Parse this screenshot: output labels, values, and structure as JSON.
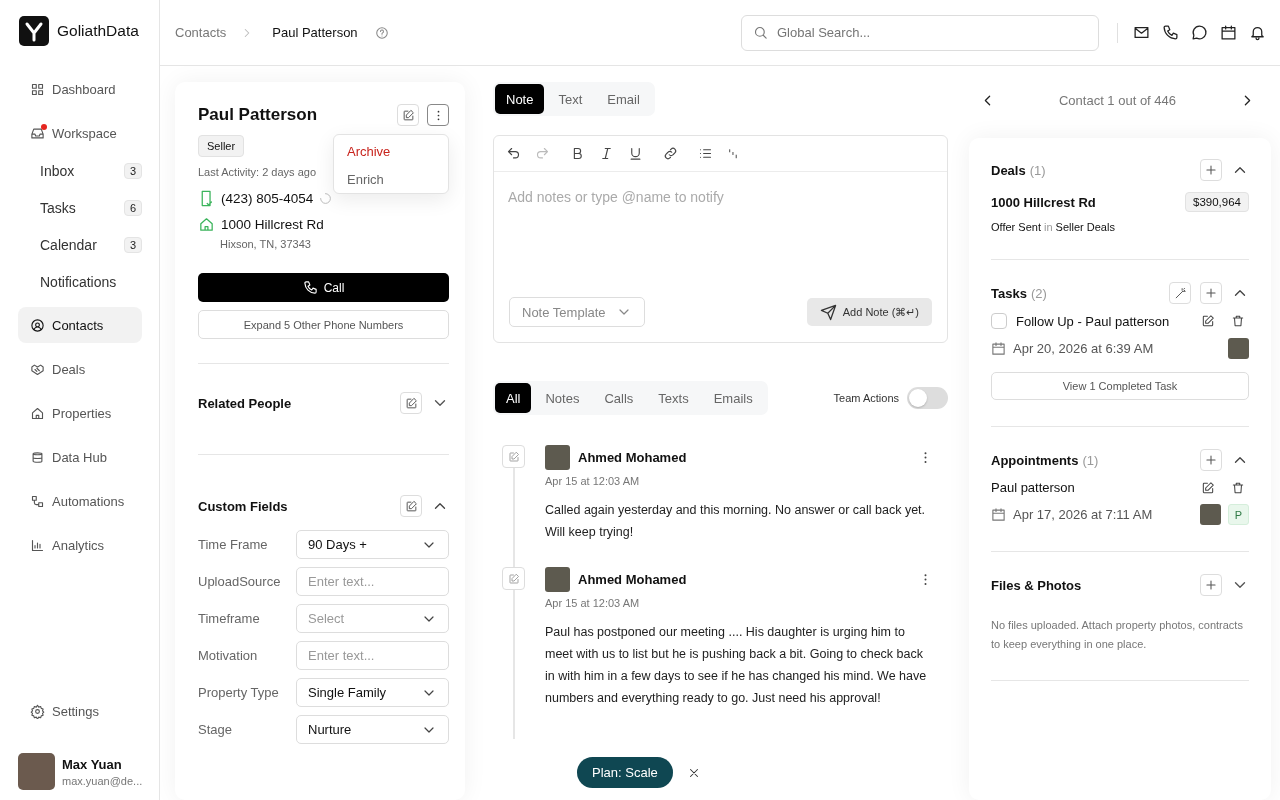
{
  "brand": {
    "name": "GoliathData"
  },
  "nav": [
    {
      "label": "Dashboard",
      "selected": false,
      "alert": false
    },
    {
      "label": "Workspace",
      "selected": false,
      "alert": true,
      "children": [
        {
          "label": "Inbox",
          "count": "3",
          "selected": false
        },
        {
          "label": "Tasks",
          "count": "6",
          "selected": false
        },
        {
          "label": "Calendar",
          "count": "3",
          "selected": false
        },
        {
          "label": "Notifications",
          "selected": false
        }
      ]
    },
    {
      "label": "Contacts",
      "selected": true,
      "alert": false
    },
    {
      "label": "Deals",
      "selected": false,
      "alert": false
    },
    {
      "label": "Properties",
      "selected": false,
      "alert": false
    },
    {
      "label": "Data Hub",
      "selected": false,
      "alert": false
    },
    {
      "label": "Automations",
      "selected": false,
      "alert": false
    },
    {
      "label": "Analytics",
      "selected": false,
      "alert": false
    }
  ],
  "settings": {
    "label": "Settings"
  },
  "user": {
    "name": "Max Yuan",
    "email": "max.yuan@de..."
  },
  "breadcrumb": [
    "Contacts",
    "Paul Patterson"
  ],
  "search": {
    "placeholder": "Global Search..."
  },
  "contact": {
    "name": "Paul Patterson",
    "tag": "Seller",
    "last_activity": "Last Activity: 2 days ago",
    "menu": [
      {
        "label": "Archive",
        "kind": "danger"
      },
      {
        "label": "Enrich",
        "kind": "normal"
      }
    ],
    "phone": "(423) 805-4054",
    "address_line1": "1000 Hillcrest Rd",
    "address_line2": "Hixson, TN, 37343",
    "call_button": "Call",
    "expand_button": "Expand 5 Other Phone Numbers"
  },
  "related_people": {
    "title": "Related People",
    "expanded": false
  },
  "custom_fields": {
    "title": "Custom Fields",
    "expanded": true,
    "fields": [
      {
        "label": "Time Frame",
        "kind": "select",
        "value": "90 Days +"
      },
      {
        "label": "UploadSource",
        "kind": "text",
        "placeholder": "Enter text..."
      },
      {
        "label": "Timeframe",
        "kind": "select",
        "placeholder": "Select"
      },
      {
        "label": "Motivation",
        "kind": "text",
        "placeholder": "Enter text..."
      },
      {
        "label": "Property Type",
        "kind": "select",
        "value": "Single Family"
      },
      {
        "label": "Stage",
        "kind": "select",
        "value": "Nurture"
      }
    ]
  },
  "composer": {
    "tabs": [
      {
        "label": "Note",
        "selected": true
      },
      {
        "label": "Text",
        "selected": false
      },
      {
        "label": "Email",
        "selected": false
      }
    ],
    "placeholder": "Add notes or type @name to notify",
    "template": {
      "placeholder": "Note Template"
    },
    "submit": "Add Note (⌘↵)"
  },
  "activity": {
    "filters": [
      {
        "label": "All",
        "selected": true
      },
      {
        "label": "Notes",
        "selected": false
      },
      {
        "label": "Calls",
        "selected": false
      },
      {
        "label": "Texts",
        "selected": false
      },
      {
        "label": "Emails",
        "selected": false
      }
    ],
    "team_actions": {
      "label": "Team Actions",
      "on": false
    },
    "notes": [
      {
        "author": "Ahmed Mohamed",
        "time": "Apr 15 at 12:03 AM",
        "text": "Called again yesterday and this morning. No answer or call back yet. Will keep trying!"
      },
      {
        "author": "Ahmed Mohamed",
        "time": "Apr 15 at 12:03 AM",
        "text": "Paul has postponed our meeting .... His daughter is urging him to meet with us to list but he is pushing back a bit. Going to check back in with him in a few days to see if he has changed his mind. We have numbers and everything ready to go. Just need his approval!"
      }
    ]
  },
  "plan": {
    "label": "Plan: Scale"
  },
  "pager": {
    "label": "Contact 1 out of 446"
  },
  "deals": {
    "title": "Deals",
    "count": "(1)",
    "expanded": true,
    "items": [
      {
        "address": "1000 Hillcrest Rd",
        "amount": "$390,964",
        "stage": "Offer Sent",
        "joiner": "in",
        "pipeline": "Seller Deals"
      }
    ]
  },
  "tasks": {
    "title": "Tasks",
    "count": "(2)",
    "expanded": true,
    "items": [
      {
        "title": "Follow Up - Paul patterson",
        "checked": false,
        "due": "Apr 20, 2026 at 6:39 AM"
      }
    ],
    "completed_button": "View 1 Completed Task"
  },
  "appointments": {
    "title": "Appointments",
    "count": "(1)",
    "expanded": true,
    "items": [
      {
        "title": "Paul patterson",
        "when": "Apr 17, 2026 at 7:11 AM",
        "initial": "P"
      }
    ]
  },
  "files": {
    "title": "Files & Photos",
    "expanded": false,
    "empty_text": "No files uploaded. Attach property photos, contracts to keep everything in one place."
  }
}
